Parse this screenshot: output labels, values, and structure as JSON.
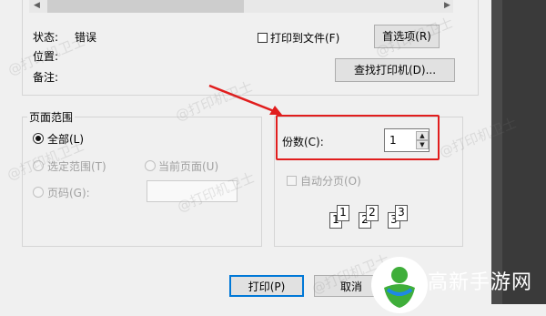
{
  "status": {
    "status_label": "状态:",
    "status_value": "错误",
    "location_label": "位置:",
    "comment_label": "备注:"
  },
  "print_to_file": {
    "label": "打印到文件(F)"
  },
  "buttons": {
    "preferences": "首选项(R)",
    "find_printer": "查找打印机(D)...",
    "print": "打印(P)",
    "cancel": "取消"
  },
  "page_range": {
    "title": "页面范围",
    "all": "全部(L)",
    "selection": "选定范围(T)",
    "current_page": "当前页面(U)",
    "pages": "页码(G):"
  },
  "copies": {
    "label": "份数(C):",
    "value": "1",
    "collate": "自动分页(O)"
  },
  "collate_pages": [
    "1",
    "1",
    "2",
    "2",
    "3",
    "3"
  ],
  "watermark": "@打印机卫士",
  "logo": {
    "text": "高新手游网",
    "colors": {
      "green": "#3fae3a",
      "blue": "#1e88e5"
    }
  },
  "colors": {
    "highlight": "#e11d1d",
    "accent": "#0078d7"
  }
}
